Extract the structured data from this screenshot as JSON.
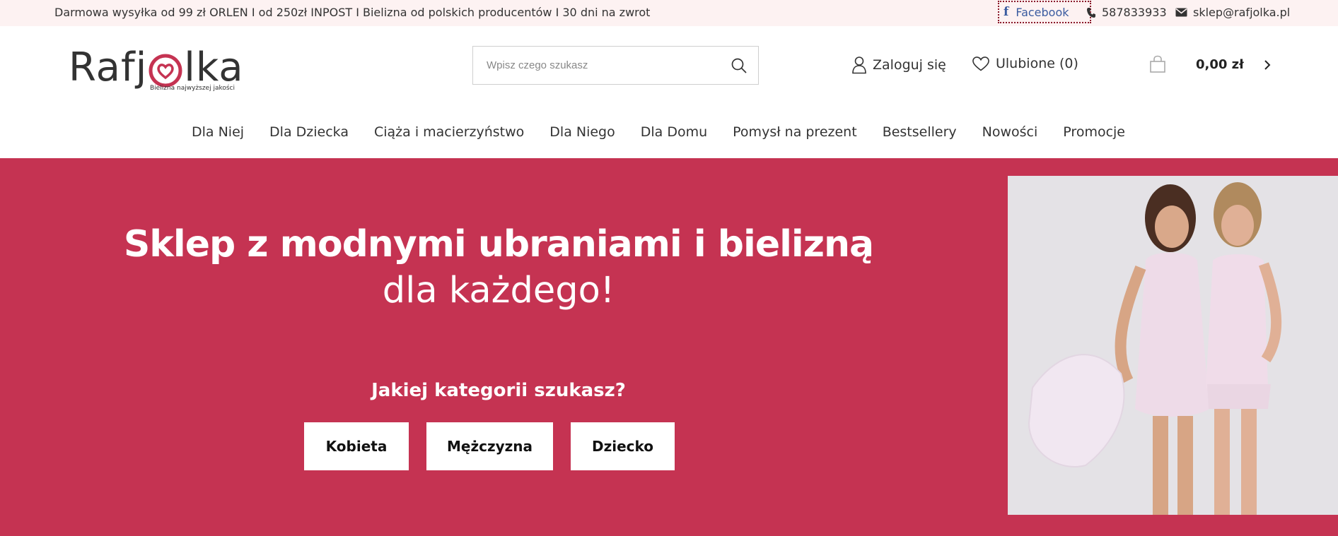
{
  "topbar": {
    "promo": "Darmowa wysyłka od 99 zł ORLEN I od 250zł INPOST I Bielizna od polskich producentów I 30 dni na zwrot",
    "facebook": "Facebook",
    "phone": "587833933",
    "email": "sklep@rafjolka.pl"
  },
  "logo": {
    "name": "Rafjolka",
    "tagline": "Bielizna najwyższej jakości"
  },
  "search": {
    "placeholder": "Wpisz czego szukasz"
  },
  "header": {
    "login": "Zaloguj się",
    "favorites": "Ulubione (0)",
    "cart_total": "0,00 zł"
  },
  "nav": {
    "items": [
      {
        "label": "Dla Niej"
      },
      {
        "label": "Dla Dziecka"
      },
      {
        "label": "Ciąża i macierzyństwo"
      },
      {
        "label": "Dla Niego"
      },
      {
        "label": "Dla Domu"
      },
      {
        "label": "Pomysł na prezent"
      },
      {
        "label": "Bestsellery"
      },
      {
        "label": "Nowości"
      },
      {
        "label": "Promocje"
      }
    ]
  },
  "hero": {
    "title": "Sklep z modnymi ubraniami i bielizną",
    "subtitle": "dla każdego!",
    "question": "Jakiej kategorii szukasz?",
    "categories": [
      {
        "label": "Kobieta"
      },
      {
        "label": "Mężczyzna"
      },
      {
        "label": "Dziecko"
      }
    ]
  },
  "colors": {
    "accent": "#c53352",
    "topbar_bg": "#fdf2f2",
    "facebook": "#3a5ba0"
  }
}
